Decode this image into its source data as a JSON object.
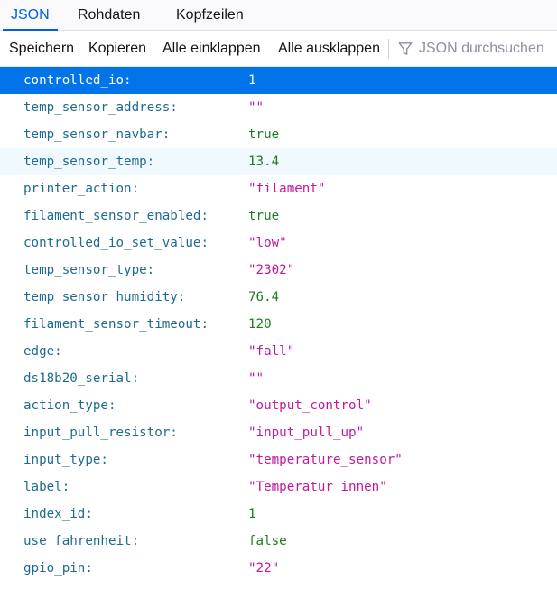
{
  "tabs": [
    {
      "label": "JSON",
      "active": true
    },
    {
      "label": "Rohdaten",
      "active": false
    },
    {
      "label": "Kopfzeilen",
      "active": false
    }
  ],
  "toolbar": {
    "save": "Speichern",
    "copy": "Kopieren",
    "collapse_all": "Alle einklappen",
    "expand_all": "Alle ausklappen",
    "filter_placeholder": "JSON durchsuchen"
  },
  "colors": {
    "accent": "#0061e0",
    "selected_row": "#0074e8",
    "key": "#1f6b8f",
    "string": "#c3189d",
    "number": "#1d7d1d"
  },
  "rows": [
    {
      "key": "controlled_io:",
      "value": "1",
      "type": "number",
      "state": "selected"
    },
    {
      "key": "temp_sensor_address:",
      "value": "\"\"",
      "type": "string"
    },
    {
      "key": "temp_sensor_navbar:",
      "value": "true",
      "type": "boolean"
    },
    {
      "key": "temp_sensor_temp:",
      "value": "13.4",
      "type": "number",
      "state": "hover"
    },
    {
      "key": "printer_action:",
      "value": "\"filament\"",
      "type": "string"
    },
    {
      "key": "filament_sensor_enabled:",
      "value": "true",
      "type": "boolean"
    },
    {
      "key": "controlled_io_set_value:",
      "value": "\"low\"",
      "type": "string"
    },
    {
      "key": "temp_sensor_type:",
      "value": "\"2302\"",
      "type": "string"
    },
    {
      "key": "temp_sensor_humidity:",
      "value": "76.4",
      "type": "number"
    },
    {
      "key": "filament_sensor_timeout:",
      "value": "120",
      "type": "number"
    },
    {
      "key": "edge:",
      "value": "\"fall\"",
      "type": "string"
    },
    {
      "key": "ds18b20_serial:",
      "value": "\"\"",
      "type": "string"
    },
    {
      "key": "action_type:",
      "value": "\"output_control\"",
      "type": "string"
    },
    {
      "key": "input_pull_resistor:",
      "value": "\"input_pull_up\"",
      "type": "string"
    },
    {
      "key": "input_type:",
      "value": "\"temperature_sensor\"",
      "type": "string"
    },
    {
      "key": "label:",
      "value": "\"Temperatur innen\"",
      "type": "string"
    },
    {
      "key": "index_id:",
      "value": "1",
      "type": "number"
    },
    {
      "key": "use_fahrenheit:",
      "value": "false",
      "type": "boolean"
    },
    {
      "key": "gpio_pin:",
      "value": "\"22\"",
      "type": "string"
    }
  ]
}
